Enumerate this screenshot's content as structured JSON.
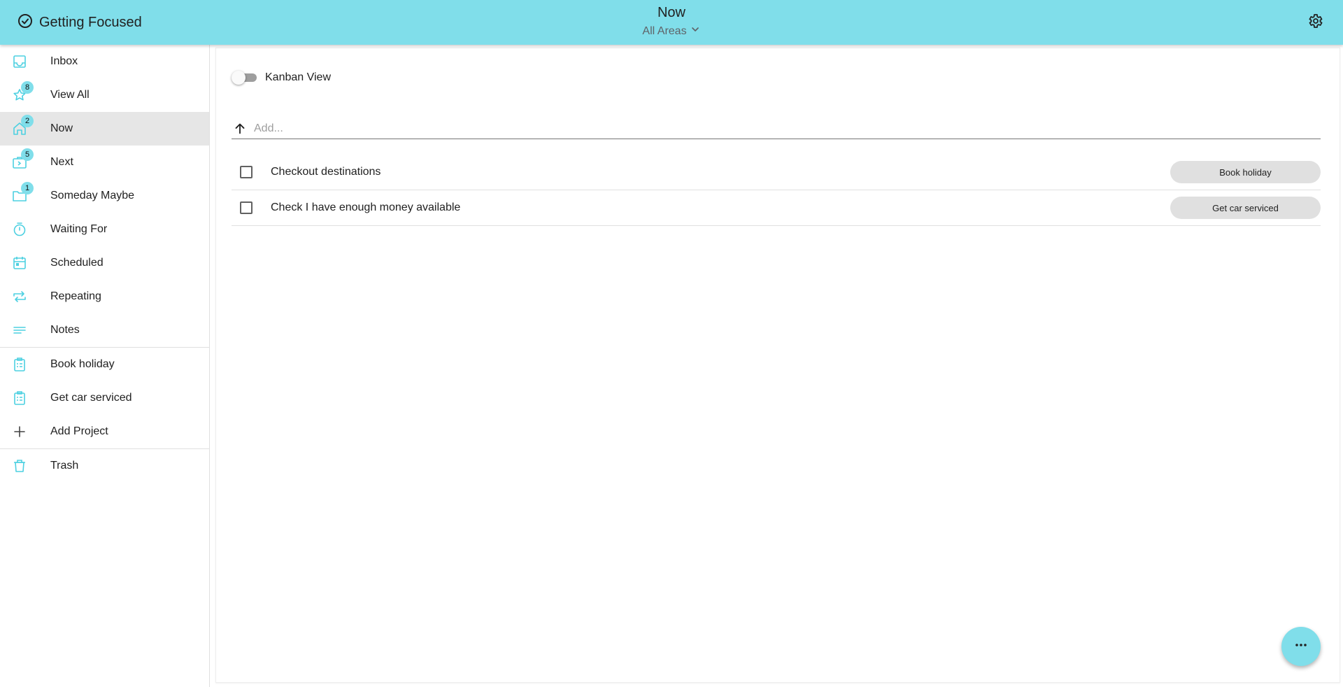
{
  "header": {
    "app_name": "Getting Focused",
    "title": "Now",
    "area_selector": "All Areas"
  },
  "sidebar": {
    "items": [
      {
        "label": "Inbox",
        "icon": "inbox-icon"
      },
      {
        "label": "View All",
        "icon": "star-icon",
        "badge": "8"
      },
      {
        "label": "Now",
        "icon": "home-icon",
        "badge": "2",
        "active": true
      },
      {
        "label": "Next",
        "icon": "next-icon",
        "badge": "5"
      },
      {
        "label": "Someday Maybe",
        "icon": "folder-icon",
        "badge": "1"
      },
      {
        "label": "Waiting For",
        "icon": "timer-icon"
      },
      {
        "label": "Scheduled",
        "icon": "calendar-icon"
      },
      {
        "label": "Repeating",
        "icon": "repeat-icon"
      },
      {
        "label": "Notes",
        "icon": "notes-icon"
      }
    ],
    "projects": [
      {
        "label": "Book holiday",
        "icon": "project-icon"
      },
      {
        "label": "Get car serviced",
        "icon": "project-icon"
      },
      {
        "label": "Add Project",
        "icon": "plus-icon"
      }
    ],
    "trash": {
      "label": "Trash",
      "icon": "trash-icon"
    }
  },
  "main": {
    "kanban_label": "Kanban View",
    "kanban_on": false,
    "add_placeholder": "Add...",
    "tasks": [
      {
        "text": "Checkout destinations",
        "project": "Book holiday",
        "done": false
      },
      {
        "text": "Check I have enough money available",
        "project": "Get car serviced",
        "done": false
      }
    ]
  },
  "colors": {
    "accent": "#80deea",
    "icon": "#4dd0e1",
    "active_row": "#e6e6e6"
  }
}
